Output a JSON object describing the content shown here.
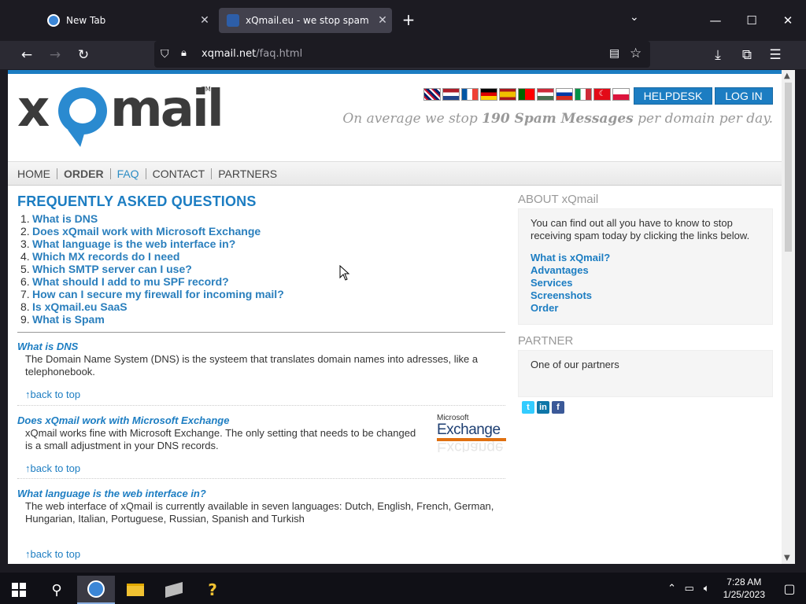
{
  "browser": {
    "tabs": [
      {
        "title": "New Tab",
        "close": "✕"
      },
      {
        "title": "xQmail.eu - we stop spam",
        "close": "✕"
      }
    ],
    "new_tab": "+",
    "tab_list": "⌄",
    "window_controls": {
      "minimize": "—",
      "maximize": "☐",
      "close": "✕"
    },
    "nav": {
      "back": "←",
      "forward": "→",
      "reload": "↻",
      "download": "⤓",
      "extensions": "⧉",
      "menu": "☰"
    },
    "url": {
      "host": "xqmail.net",
      "path": "/faq.html"
    }
  },
  "page": {
    "logo": {
      "x": "x",
      "mail": "mail",
      "tm": "TM"
    },
    "flags": [
      "GB",
      "NL",
      "FR",
      "DE",
      "ES",
      "PT",
      "HU",
      "RU",
      "IT",
      "TR",
      "PL"
    ],
    "buttons": {
      "helpdesk": "HELPDESK",
      "login": "LOG IN"
    },
    "tagline": {
      "pre": "On average we stop ",
      "bold": "190 Spam Messages",
      "post": " per domain per day."
    },
    "menu": [
      "HOME",
      "ORDER",
      "FAQ",
      "CONTACT",
      "PARTNERS"
    ],
    "faq_title": "FREQUENTLY ASKED QUESTIONS",
    "toc": [
      {
        "num": "1.",
        "text": "What is DNS"
      },
      {
        "num": "2.",
        "text": "Does xQmail work with Microsoft Exchange"
      },
      {
        "num": "3.",
        "text": "What language is the web interface in?"
      },
      {
        "num": "4.",
        "text": "Which MX records do I need"
      },
      {
        "num": "5.",
        "text": "Which SMTP server can I use?"
      },
      {
        "num": "6.",
        "text": "What should I add to mu SPF record?"
      },
      {
        "num": "7.",
        "text": "How can I secure my firewall for incoming mail?"
      },
      {
        "num": "8.",
        "text": "Is xQmail.eu SaaS"
      },
      {
        "num": "9.",
        "text": "What is Spam"
      }
    ],
    "qa": [
      {
        "title": "What is DNS",
        "answer": "The Domain Name System (DNS) is the systeem that translates domain names into adresses, like a telephonebook.",
        "back": "↑back to top"
      },
      {
        "title": "Does xQmail work with Microsoft Exchange",
        "answer": "xQmail works fine with Microsoft Exchange. The only setting that needs to be changed is a small adjustment in your DNS records.",
        "back": "↑back to top"
      },
      {
        "title": "What language is the web interface in?",
        "answer": "The web interface of xQmail is currently available in seven languages: Dutch, English, French, German, Hungarian, Italian, Portuguese, Russian, Spanish and Turkish",
        "back": "↑back to top"
      }
    ],
    "exchange_logo": {
      "microsoft": "Microsoft",
      "exchange": "Exchange"
    },
    "sidebar": {
      "about_head": "ABOUT xQmail",
      "about_text": "You can find out all you have to know to stop receiving spam today by clicking the links below.",
      "links": [
        "What is xQmail?",
        "Advantages",
        "Services",
        "Screenshots",
        "Order"
      ],
      "partner_head": "PARTNER",
      "partner_text": "One of our partners",
      "social": [
        "t",
        "in",
        "f"
      ]
    }
  },
  "taskbar": {
    "time": "7:28 AM",
    "date": "1/25/2023"
  },
  "colors": {
    "accent": "#1c7dc2",
    "link": "#2a7fbd",
    "chrome_bg": "#1c1b22",
    "navbar_bg": "#2b2a33"
  }
}
